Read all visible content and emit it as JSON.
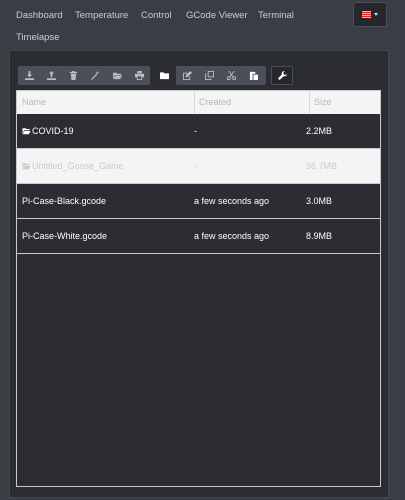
{
  "nav": {
    "tabs": [
      {
        "label": "Dashboard"
      },
      {
        "label": "Temperature"
      },
      {
        "label": "Control"
      },
      {
        "label": "GCode Viewer"
      },
      {
        "label": "Terminal"
      },
      {
        "label": "Timelapse"
      }
    ],
    "language_icon": "flag-icon"
  },
  "toolbar": {
    "icons": [
      "download-icon",
      "upload-icon",
      "trash-icon",
      "magic-wand-icon",
      "folder-open-icon",
      "print-icon",
      "folder-icon",
      "edit-icon",
      "copy-icon",
      "cut-icon",
      "paste-icon",
      "wrench-icon"
    ]
  },
  "table": {
    "headers": {
      "name": "Name",
      "created": "Created",
      "size": "Size"
    },
    "rows": [
      {
        "name": "COVID-19",
        "created": "-",
        "size": "2.2MB",
        "type": "folder"
      },
      {
        "name": "Untitled_Goose_Game",
        "created": "-",
        "size": "36.7MB",
        "type": "folder"
      },
      {
        "name": "Pi-Case-Black.gcode",
        "created": "a few seconds ago",
        "size": "3.0MB",
        "type": "file"
      },
      {
        "name": "Pi-Case-White.gcode",
        "created": "a few seconds ago",
        "size": "8.9MB",
        "type": "file"
      }
    ]
  },
  "colors": {
    "background": "#3a3d44",
    "panel": "#2b2d32",
    "row_light": "#f4f4f5",
    "accent": "#ffffff"
  }
}
